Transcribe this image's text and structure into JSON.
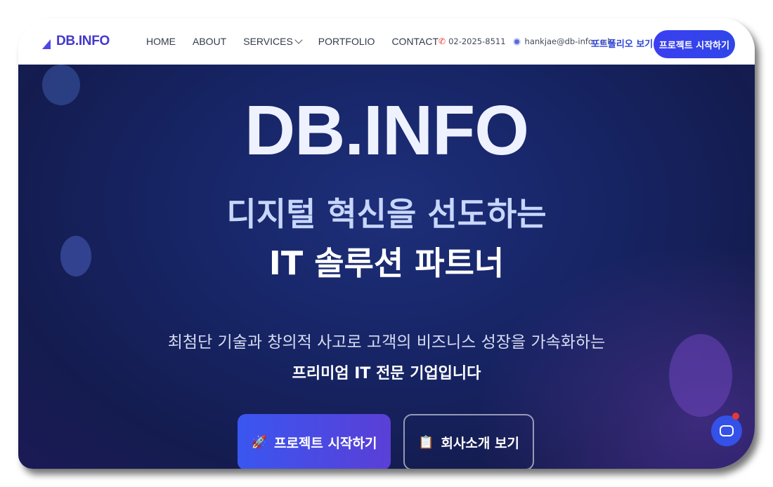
{
  "nav": {
    "logo": "DB.INFO",
    "items": [
      {
        "label": "HOME"
      },
      {
        "label": "ABOUT"
      },
      {
        "label": "SERVICES"
      },
      {
        "label": "PORTFOLIO"
      },
      {
        "label": "CONTACT"
      }
    ],
    "phone": "02-2025-8511",
    "email": "hankjae@db-info.co.kr",
    "portfolio_link": "포트폴리오 보기",
    "cta": "프로젝트 시작하기"
  },
  "hero": {
    "title": "DB.INFO",
    "subtitle_line1": "디지털 혁신을 선도하는",
    "subtitle_line2": "IT 솔루션 파트너",
    "desc_line1": "최첨단 기술과 창의적 사고로 고객의 비즈니스 성장을 가속화하는",
    "desc_line2": "프리미엄 IT 전문 기업입니다",
    "primary_button": "프로젝트 시작하기",
    "primary_icon": "🚀",
    "secondary_button": "회사소개 보기",
    "secondary_icon": "📋"
  },
  "colors": {
    "brand": "#4338ca",
    "cta": "#3b3ff0",
    "hero_bg": "#172566"
  }
}
